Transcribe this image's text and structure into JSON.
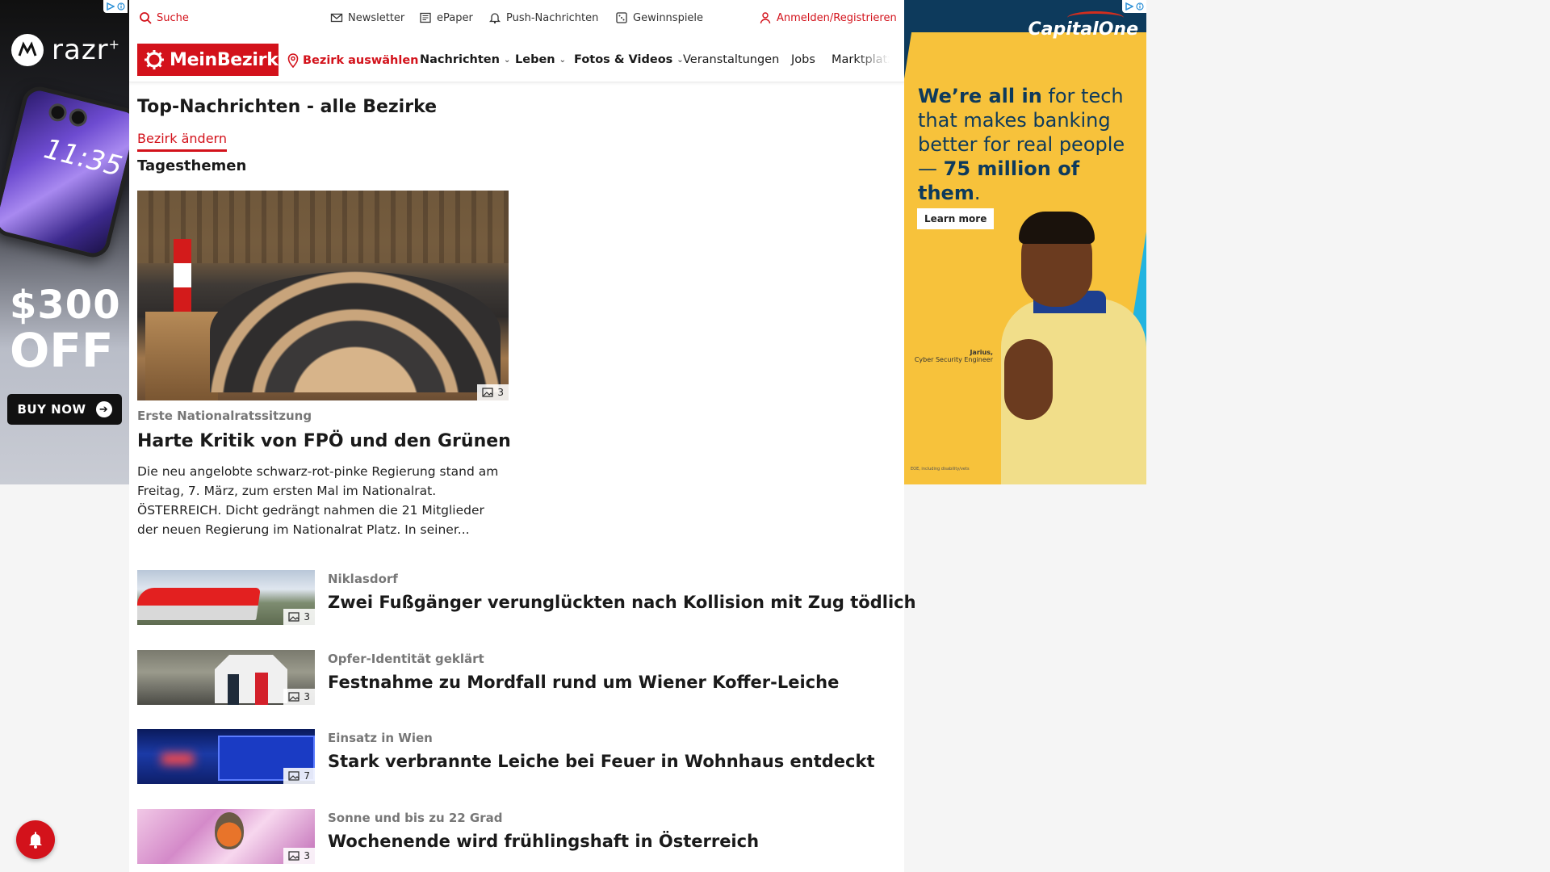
{
  "topbar": {
    "search": "Suche",
    "newsletter": "Newsletter",
    "epaper": "ePaper",
    "push": "Push-Nachrichten",
    "contests": "Gewinnspiele",
    "login": "Anmelden/Registrieren"
  },
  "nav": {
    "logo": "MeinBezirk",
    "district": "Bezirk auswählen",
    "items": [
      "Nachrichten",
      "Leben",
      "Fotos & Videos",
      "Veranstaltungen",
      "Jobs",
      "Marktplatz"
    ]
  },
  "page": {
    "title": "Top-Nachrichten - alle Bezirke",
    "change_district": "Bezirk ändern",
    "section": "Tagesthemen"
  },
  "lead": {
    "image_count": "3",
    "kicker": "Erste Nationalratssitzung",
    "title": "Harte Kritik von FPÖ und den Grünen",
    "teaser": "Die neu angelobte schwarz-rot-pinke Regierung stand am Freitag, 7. März, zum ersten Mal im Nationalrat. ÖSTERREICH. Dicht gedrängt nahmen die 21 Mitglieder der neuen Regierung im Nationalrat Platz. In seiner..."
  },
  "articles": [
    {
      "kicker": "Niklasdorf",
      "title": "Zwei Fußgänger verunglückten nach Kollision mit Zug tödlich",
      "image_count": "3"
    },
    {
      "kicker": "Opfer-Identität geklärt",
      "title": "Festnahme zu Mordfall rund um Wiener Koffer-Leiche",
      "image_count": "3"
    },
    {
      "kicker": "Einsatz in Wien",
      "title": "Stark verbrannte Leiche bei Feuer in Wohnhaus entdeckt",
      "image_count": "7"
    },
    {
      "kicker": "Sonne und bis zu 22 Grad",
      "title": "Wochenende wird frühlingshaft in Österreich",
      "image_count": "3"
    }
  ],
  "ad_left": {
    "brand": "razr",
    "brand_sup": "+",
    "phone_time": "11:35",
    "amount": "$300",
    "off": "OFF",
    "cta": "BUY NOW"
  },
  "ad_right": {
    "brand": "CapitalOne",
    "line1_bold": "We’re all in",
    "line1_rest": " for tech that makes banking better for real people—",
    "line2_bold": "75 million of them",
    "line2_end": ".",
    "cta": "Learn more",
    "caption_name": "Jarius,",
    "caption_role": "Cyber Security Engineer",
    "fine_print": "EOE, including disability/vets"
  },
  "colors": {
    "brand_red": "#d3121b",
    "ad_navy": "#0d3a5c",
    "ad_yellow": "#f7c23b"
  },
  "icons": [
    "search-icon",
    "envelope-icon",
    "newspaper-icon",
    "bell-icon",
    "gift-icon",
    "user-icon",
    "map-pin-icon",
    "chevron-down-icon",
    "image-icon",
    "adchoices-icon"
  ]
}
